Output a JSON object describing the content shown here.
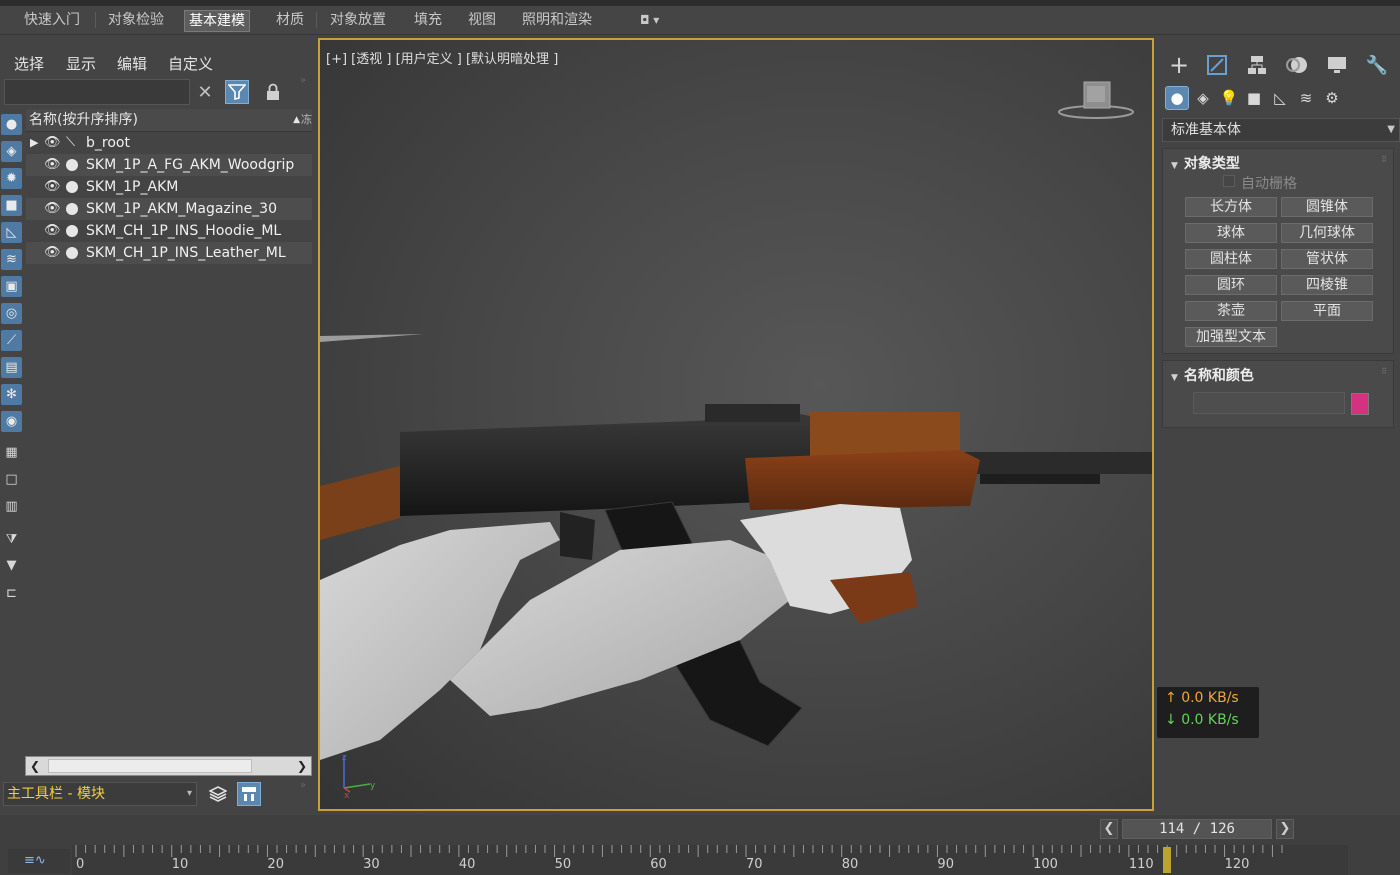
{
  "ribbon": {
    "tabs": [
      {
        "label": "快速入门"
      },
      {
        "label": "对象检验"
      },
      {
        "label": "基本建模",
        "active": true
      },
      {
        "label": "材质"
      },
      {
        "label": "对象放置"
      },
      {
        "label": "填充"
      },
      {
        "label": "视图"
      },
      {
        "label": "照明和渲染"
      }
    ]
  },
  "scene_explorer": {
    "menu": [
      "选择",
      "显示",
      "编辑",
      "自定义"
    ],
    "search_value": "",
    "column_header": "名称(按升序排序)",
    "tree": [
      {
        "name": "b_root",
        "type": "bone",
        "expandable": true
      },
      {
        "name": "SKM_1P_A_FG_AKM_Woodgrip",
        "type": "mesh"
      },
      {
        "name": "SKM_1P_AKM",
        "type": "mesh"
      },
      {
        "name": "SKM_1P_AKM_Magazine_30",
        "type": "mesh"
      },
      {
        "name": "SKM_CH_1P_INS_Hoodie_ML",
        "type": "mesh"
      },
      {
        "name": "SKM_CH_1P_INS_Leather_ML",
        "type": "mesh"
      }
    ],
    "toolbar_dropdown": "主工具栏 - 模块"
  },
  "viewport": {
    "label": "[+] [透视 ] [用户定义 ] [默认明暗处理 ]",
    "border_color": "#c9a13a"
  },
  "command_panel": {
    "category": "标准基本体",
    "object_type": {
      "title": "对象类型",
      "autogrid_label": "自动栅格",
      "buttons": [
        "长方体",
        "圆锥体",
        "球体",
        "几何球体",
        "圆柱体",
        "管状体",
        "圆环",
        "四棱锥",
        "茶壶",
        "平面",
        "加强型文本"
      ]
    },
    "name_color": {
      "title": "名称和颜色",
      "name_value": "",
      "swatch_color": "#d4317f"
    }
  },
  "net_speed": {
    "upload": "0.0 KB/s",
    "download": "0.0 KB/s",
    "upload_color": "#f0a63a",
    "download_color": "#66d25a"
  },
  "timeline": {
    "frame_counter": "114 / 126",
    "current_frame": 114,
    "total_frames": 126,
    "tick_labels": [
      "0",
      "10",
      "20",
      "30",
      "40",
      "50",
      "60",
      "70",
      "80",
      "90",
      "100",
      "110",
      "120"
    ]
  },
  "colors": {
    "accent": "#5b87b0",
    "toolbar_label": "#f2d03d"
  }
}
